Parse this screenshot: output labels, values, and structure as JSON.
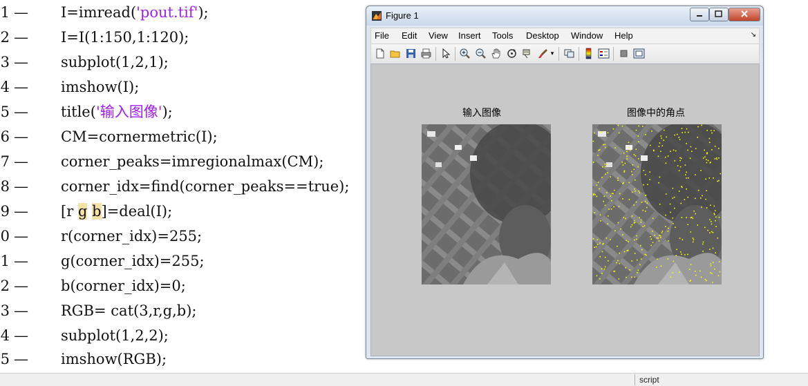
{
  "editor": {
    "lines": [
      {
        "num": "1",
        "pre": "I=imread(",
        "str": "'pout.tif'",
        "post": ");"
      },
      {
        "num": "2",
        "text": "I=I(1:150,1:120);"
      },
      {
        "num": "3",
        "text": "subplot(1,2,1);"
      },
      {
        "num": "4",
        "text": "imshow(I);"
      },
      {
        "num": "5",
        "pre": "title(",
        "str": "'输入图像'",
        "post": ");"
      },
      {
        "num": "6",
        "text": "CM=cornermetric(I);"
      },
      {
        "num": "7",
        "text": "corner_peaks=imregionalmax(CM);"
      },
      {
        "num": "8",
        "text": "corner_idx=find(corner_peaks==true);"
      },
      {
        "num": "9",
        "p1": "[r ",
        "h1": "g",
        "p2": " ",
        "h2": "b",
        "p3": "]=deal(I);"
      },
      {
        "num": "0",
        "text": "r(corner_idx)=255;"
      },
      {
        "num": "1",
        "text": "g(corner_idx)=255;"
      },
      {
        "num": "2",
        "text": "b(corner_idx)=0;"
      },
      {
        "num": "3",
        "text": "RGB= cat(3,r,g,b);"
      },
      {
        "num": "4",
        "text": "subplot(1,2,2);"
      },
      {
        "num": "5",
        "text": "imshow(RGB);"
      }
    ],
    "dash": "—"
  },
  "status": {
    "mode": "script"
  },
  "figure": {
    "title": "Figure 1",
    "menus": [
      "File",
      "Edit",
      "View",
      "Insert",
      "Tools",
      "Desktop",
      "Window",
      "Help"
    ],
    "axes": [
      {
        "title": "输入图像"
      },
      {
        "title": "图像中的角点"
      }
    ],
    "corner_color": "#ffff00"
  },
  "colors": {
    "string": "#a020f0",
    "highlight": "#f5e3a6",
    "canvas": "#c8c8c8"
  }
}
